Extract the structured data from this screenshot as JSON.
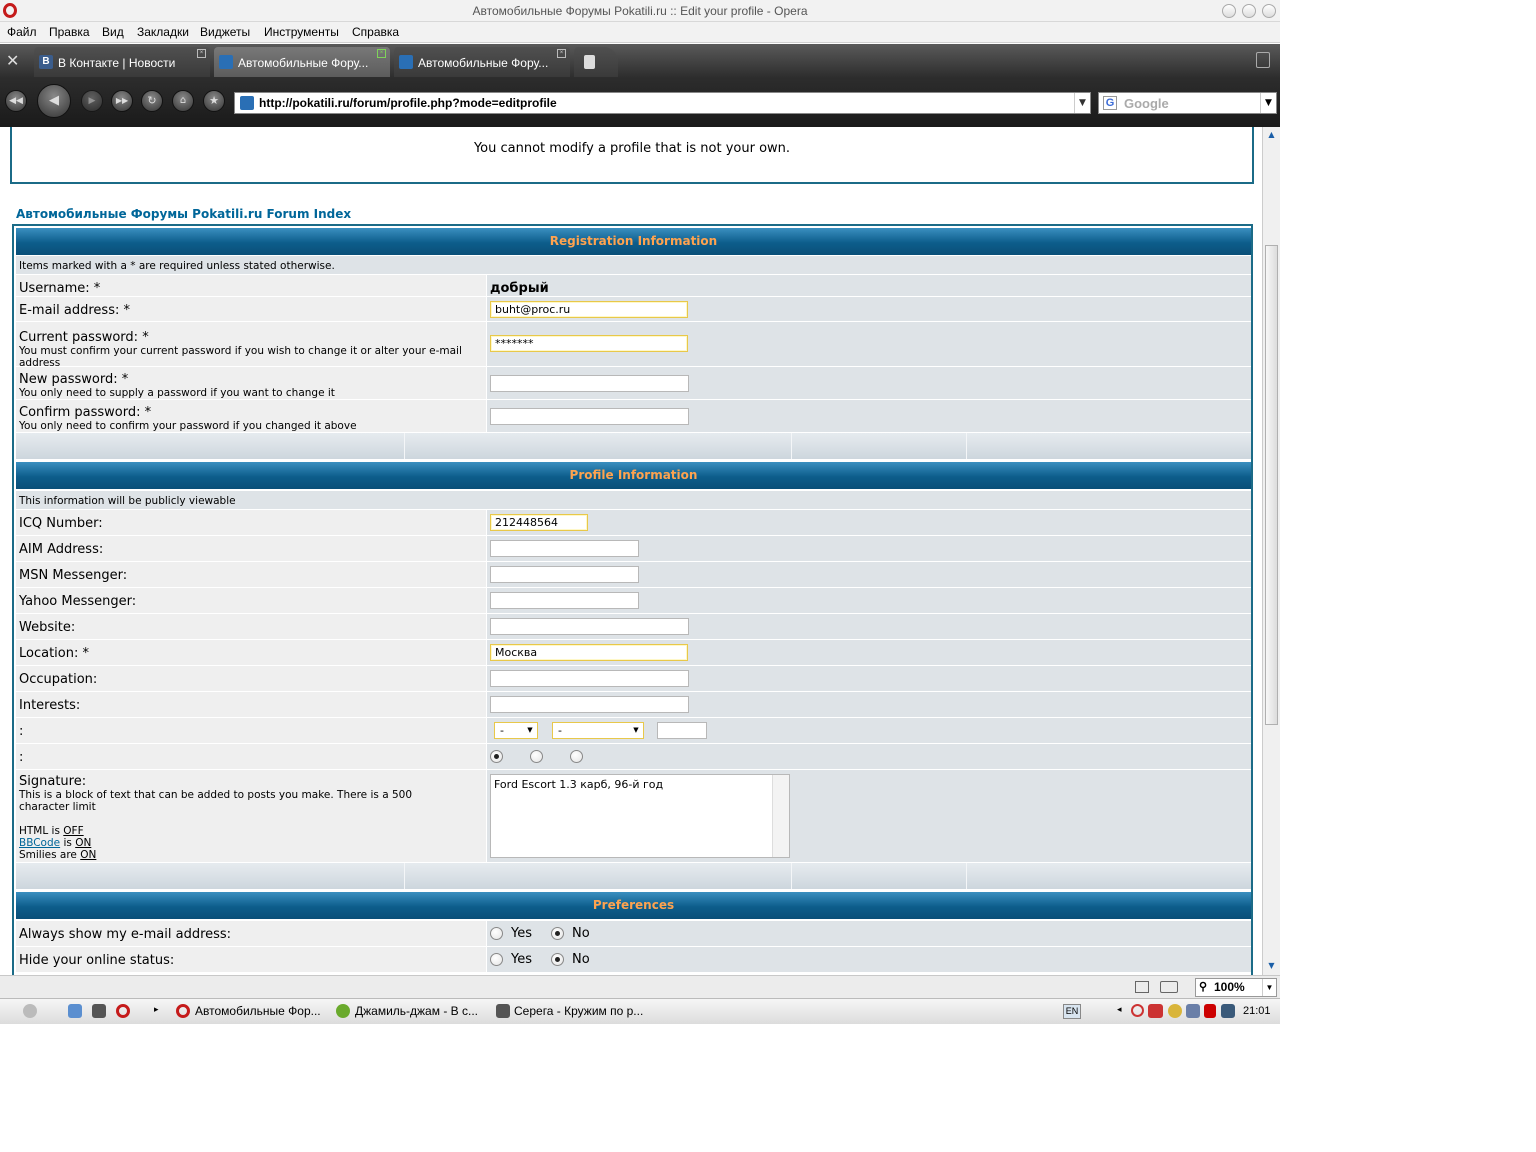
{
  "window": {
    "title": "Автомобильные Форумы Pokatili.ru :: Edit your profile - Opera"
  },
  "menu": [
    "Файл",
    "Правка",
    "Вид",
    "Закладки",
    "Виджеты",
    "Инструменты",
    "Справка"
  ],
  "tabs": [
    {
      "label": "В Контакте | Новости",
      "active": false
    },
    {
      "label": "Автомобильные Фору...",
      "active": true
    },
    {
      "label": "Автомобильные Фору...",
      "active": false
    }
  ],
  "address": {
    "url": "http://pokatili.ru/forum/profile.php?mode=editprofile",
    "search_engine": "Google"
  },
  "page": {
    "message": "You cannot modify a profile that is not your own.",
    "forum_index": "Автомобильные Форумы Pokatili.ru Forum Index",
    "registration": {
      "header": "Registration Information",
      "required_note": "Items marked with a * are required unless stated otherwise.",
      "username_label": "Username: *",
      "username_value": "добрый",
      "email_label": "E-mail address: *",
      "email_value": "buht@proc.ru",
      "current_password_label": "Current password: *",
      "current_password_note": "You must confirm your current password if you wish to change it or alter your e-mail address",
      "current_password_value": "*******",
      "new_password_label": "New password: *",
      "new_password_note": "You only need to supply a password if you want to change it",
      "confirm_password_label": "Confirm password: *",
      "confirm_password_note": "You only need to confirm your password if you changed it above"
    },
    "profile": {
      "header": "Profile Information",
      "public_note": "This information will be publicly viewable",
      "icq_label": "ICQ Number:",
      "icq_value": "212448564",
      "aim_label": "AIM Address:",
      "msn_label": "MSN Messenger:",
      "yahoo_label": "Yahoo Messenger:",
      "website_label": "Website:",
      "location_label": "Location: *",
      "location_value": "Москва",
      "occupation_label": "Occupation:",
      "interests_label": "Interests:",
      "birthday_label": ":",
      "birthday_day": "-",
      "birthday_month": "-",
      "gender_label": ":",
      "signature_label": "Signature:",
      "signature_note": "This is a block of text that can be added to posts you make. There is a 500 character limit",
      "signature_value": "Ford Escort 1.3 карб, 96-й год",
      "html_prefix": "HTML is ",
      "html_state": "OFF",
      "bbcode_link": "BBCode",
      "bbcode_mid": " is ",
      "bbcode_state": "ON",
      "smilies_prefix": "Smilies are ",
      "smilies_state": "ON"
    },
    "preferences": {
      "header": "Preferences",
      "show_email_label": "Always show my e-mail address:",
      "hide_online_label": "Hide your online status:",
      "yes": "Yes",
      "no": "No"
    }
  },
  "status": {
    "zoom": "100%"
  },
  "taskbar": {
    "items": [
      "Автомобильные Фор...",
      "Джамиль-джам - В с...",
      "Серега - Кружим по р..."
    ],
    "lang": "EN",
    "clock": "21:01"
  },
  "colors": {
    "header_bg": "#0d5d8b",
    "header_text": "#ffa34f",
    "link": "#006699",
    "row_left": "#efefef",
    "row_right": "#dee3e7"
  }
}
